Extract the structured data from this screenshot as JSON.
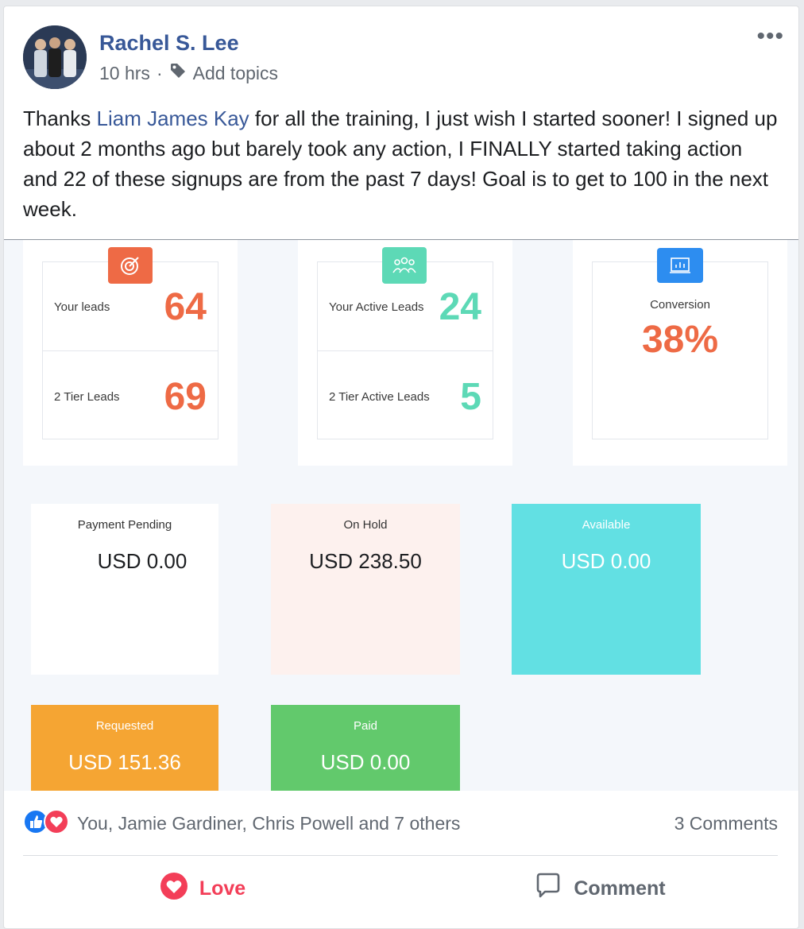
{
  "post": {
    "author": "Rachel S. Lee",
    "time": "10 hrs",
    "separator": "·",
    "topics_label": "Add topics",
    "more_label": "•••",
    "text_before": "Thanks ",
    "mention": "Liam James Kay",
    "text_after": " for all the training, I just wish I started sooner! I signed up about 2 months ago but barely took any action, I FINALLY started taking action and 22 of these signups are from the past 7 days! Goal is to get to 100 in the next week."
  },
  "dashboard": {
    "your_leads_label": "Your leads",
    "your_leads_value": "64",
    "tier_leads_label": "2 Tier Leads",
    "tier_leads_value": "69",
    "active_leads_label": "Your Active Leads",
    "active_leads_value": "24",
    "tier_active_label": "2 Tier Active Leads",
    "tier_active_value": "5",
    "conversion_label": "Conversion",
    "conversion_value": "38%",
    "payment_pending_label": "Payment Pending",
    "payment_pending_value": "USD 0.00",
    "on_hold_label": "On Hold",
    "on_hold_value": "USD 238.50",
    "available_label": "Available",
    "available_value": "USD 0.00",
    "requested_label": "Requested",
    "requested_value": "USD 151.36",
    "paid_label": "Paid",
    "paid_value": "USD 0.00"
  },
  "footer": {
    "reaction_names": "You, Jamie Gardiner, Chris Powell and 7 others",
    "comments_count": "3 Comments",
    "love_label": "Love",
    "comment_label": "Comment"
  },
  "colors": {
    "orange": "#ee6a45",
    "teal": "#5dd9b6",
    "blue": "#2d8df0",
    "available": "#62e0e3",
    "requested": "#f5a533",
    "paid": "#62c96c",
    "onhold": "#fdf1ee",
    "love": "#f33e58",
    "link": "#385898"
  }
}
